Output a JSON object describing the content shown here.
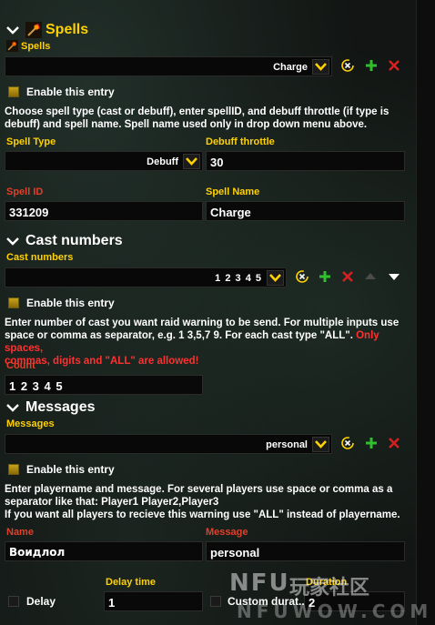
{
  "spells_section": {
    "title": "Spells",
    "sublabel": "Spells",
    "dropdown_value": "Charge",
    "enable_label": "Enable this entry",
    "description_lines": [
      "Choose spell type (cast or debuff), enter spellID, and debuff throttle (if type is",
      "debuff) and spell name. Spell name used only in drop down menu above."
    ],
    "spell_type_label": "Spell Type",
    "spell_type_value": "Debuff",
    "debuff_throttle_label": "Debuff throttle",
    "debuff_throttle_value": "30",
    "spell_id_label": "Spell ID",
    "spell_id_value": "331209",
    "spell_name_label": "Spell Name",
    "spell_name_value": "Charge"
  },
  "cast_section": {
    "title": "Cast numbers",
    "sublabel": "Cast numbers",
    "dropdown_value": "1 2 3 4 5",
    "enable_label": "Enable this entry",
    "description_lines": [
      "Enter number of cast you want raid warning to be send. For multiple inputs use",
      "space or comma as separator, e.g. 1 3,5,7 9. For each cast type \"ALL\".",
      "commas, digits and \"ALL\"  are allowed!"
    ],
    "warning_part1": " Only spaces,",
    "count_label": "Count",
    "count_value": "1 2 3 4 5"
  },
  "messages_section": {
    "title": "Messages",
    "sublabel": "Messages",
    "dropdown_value": "personal",
    "enable_label": "Enable this entry",
    "description_lines": [
      "Enter playername and message. For several players use space or comma as a",
      "separator like that: Player1 Player2,Player3",
      "If you want all players to recieve this warning use \"ALL\" instead of playername."
    ],
    "name_label": "Name",
    "name_value": "Воидлол",
    "message_label": "Message",
    "message_value": "personal",
    "delay_label": "Delay",
    "delay_time_label": "Delay time",
    "delay_time_value": "1",
    "custom_duration_label": "Custom durat...",
    "duration_label": "Duration",
    "duration_value": "2"
  },
  "watermark": {
    "brand": "NFU",
    "site_cn": "玩家社区",
    "url": "NFUWOW.COM"
  },
  "colors": {
    "gold": "#ffd100",
    "red_label": "#e0402a",
    "warning": "#ff3030",
    "add_green": "#2fbf2f",
    "delete_red": "#d42020"
  },
  "icons": {
    "collapse": "chevron-down-icon",
    "spell": "spell-icon",
    "reset": "reset-icon",
    "add": "plus-icon",
    "delete": "close-icon",
    "move_up": "arrow-up-icon",
    "move_down": "arrow-down-icon"
  }
}
